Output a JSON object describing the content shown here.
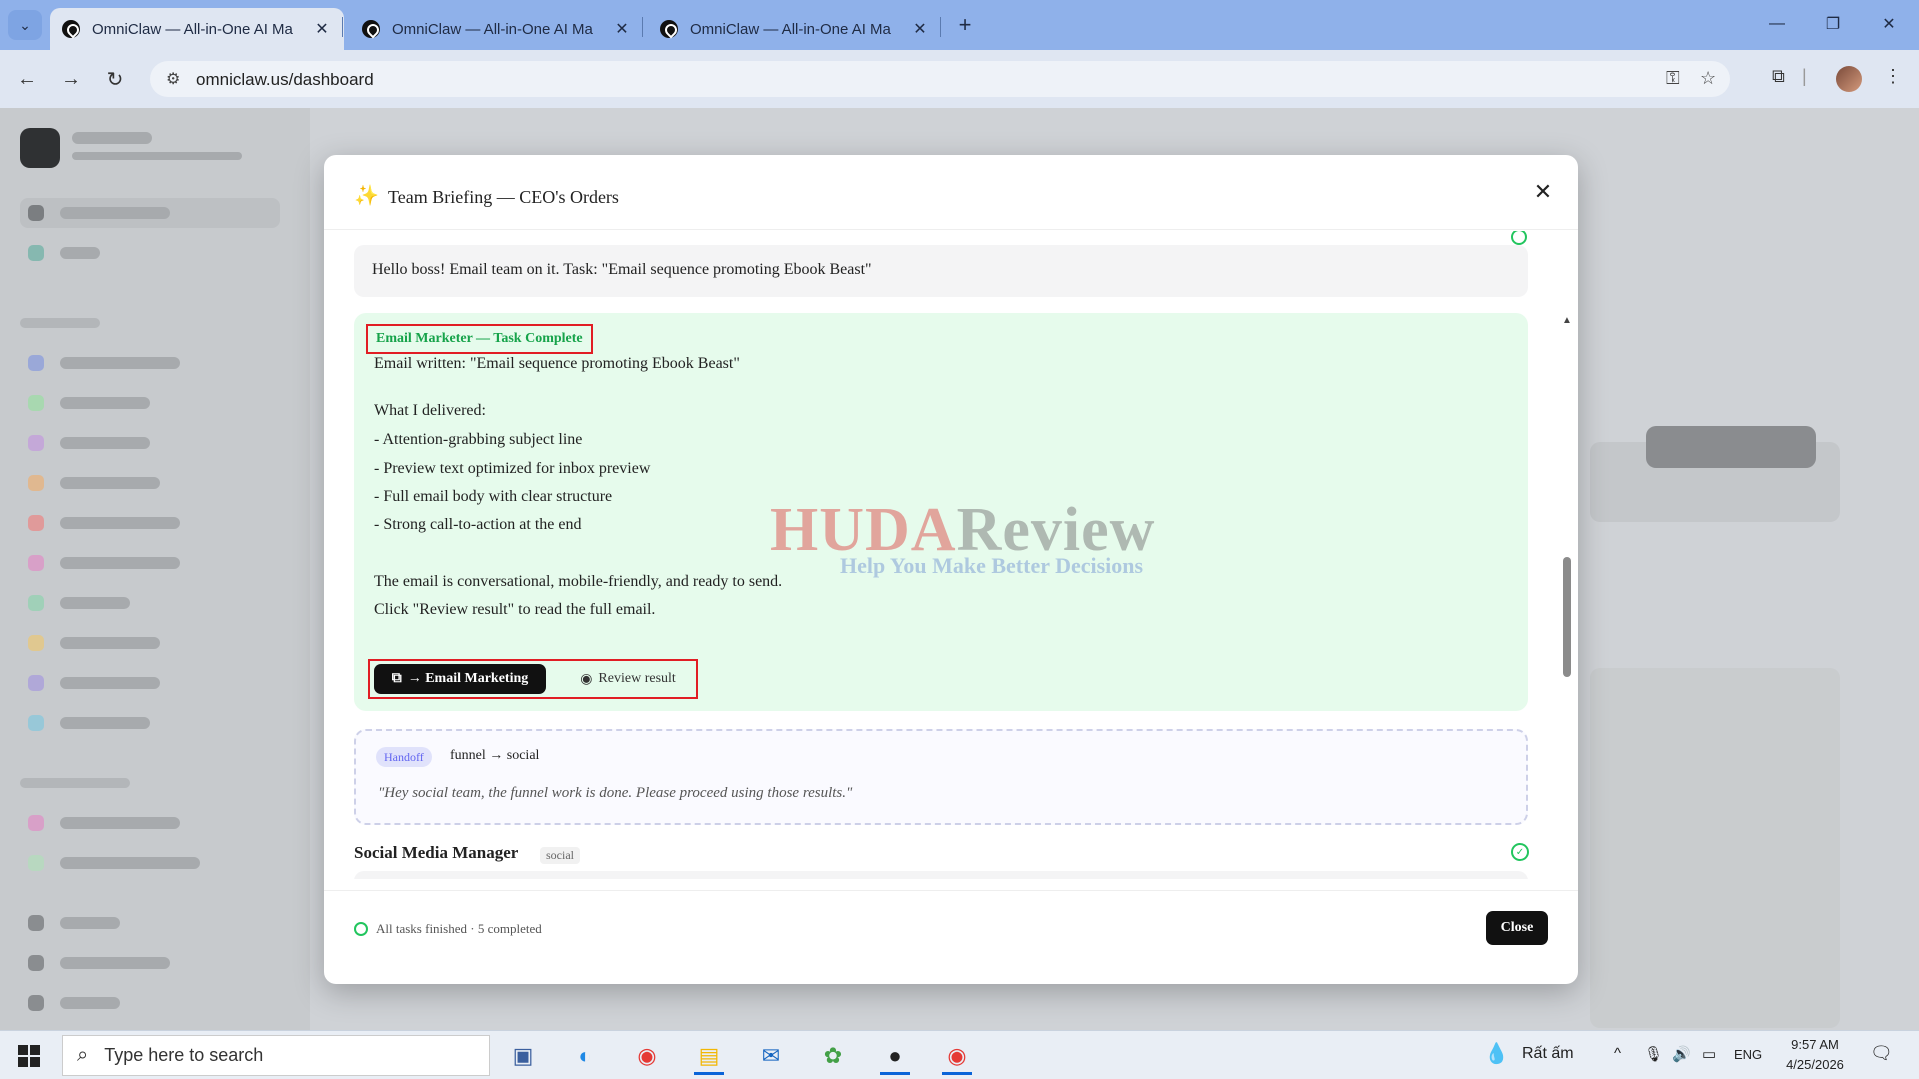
{
  "browser": {
    "tabs": [
      {
        "title": "OmniClaw — All-in-One AI Ma"
      },
      {
        "title": "OmniClaw — All-in-One AI Ma"
      },
      {
        "title": "OmniClaw — All-in-One AI Ma"
      }
    ],
    "address": "omniclaw.us/dashboard"
  },
  "modal": {
    "title": "Team Briefing — CEO's Orders",
    "boss_message": "Hello boss! Email team on it. Task: \"Email sequence promoting Ebook Beast\"",
    "result": {
      "tag": "Email Marketer — Task Complete",
      "lines": [
        "Email written: \"Email sequence promoting Ebook Beast\"",
        "What I delivered:",
        "- Attention-grabbing subject line",
        "- Preview text optimized for inbox preview",
        "- Full email body with clear structure",
        "- Strong call-to-action at the end",
        "The email is conversational, mobile-friendly, and ready to send.",
        "Click \"Review result\" to read the full email."
      ],
      "open_button": "→ Email Marketing",
      "review_button": "Review result"
    },
    "handoff": {
      "badge": "Handoff",
      "route": "funnel → social",
      "quote": "\"Hey social team, the funnel work is done. Please proceed using those results.\""
    },
    "next_section": {
      "title": "Social Media Manager",
      "tag": "social"
    },
    "footer": {
      "status": "All tasks finished · 5 completed",
      "close_label": "Close"
    }
  },
  "watermark": {
    "part1": "HUDA",
    "part2": "Review",
    "tagline": "Help You Make Better Decisions"
  },
  "taskbar": {
    "search_placeholder": "Type here to search",
    "weather": "Rất ấm",
    "language": "ENG",
    "time": "9:57 AM",
    "date": "4/25/2026"
  },
  "icons": {
    "accent_red": "#e11d24",
    "success_green": "#16a34a"
  }
}
